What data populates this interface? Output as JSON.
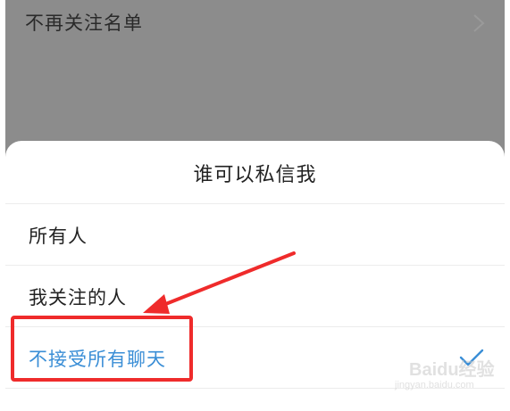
{
  "background": {
    "row_label": "不再关注名单",
    "chevron_icon": "chevron-right-icon"
  },
  "sheet": {
    "title": "谁可以私信我",
    "options": [
      {
        "label": "所有人",
        "selected": false
      },
      {
        "label": "我关注的人",
        "selected": false
      },
      {
        "label": "不接受所有聊天",
        "selected": true
      }
    ],
    "check_icon": "checkmark-icon"
  },
  "annotation": {
    "highlight_color": "#ef2b2b",
    "arrow_color": "#ef2b2b"
  },
  "watermark": {
    "text": "Baidu经验",
    "sub": "jingyan.baidu.com"
  },
  "colors": {
    "selected_text": "#3a8ed6",
    "overlay": "#8c8c8c"
  }
}
